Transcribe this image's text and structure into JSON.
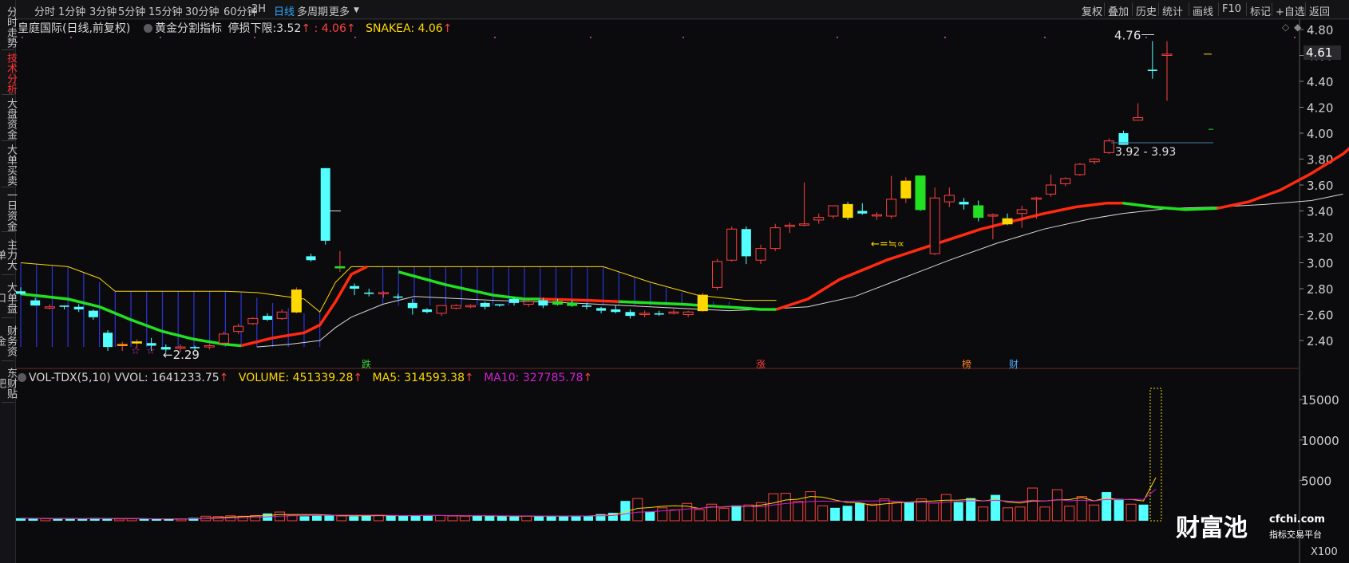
{
  "sidebar": {
    "items": [
      {
        "label": "分时走势",
        "active": false
      },
      {
        "label": "技术分析",
        "active": true
      },
      {
        "label": "大盘资金",
        "active": false
      },
      {
        "label": "大单买卖",
        "active": false
      },
      {
        "label": "一日资金",
        "active": false
      },
      {
        "label": "主力大单",
        "active": false
      },
      {
        "label": "大单盘口",
        "active": false
      },
      {
        "label": "财务资金",
        "active": false
      },
      {
        "label": "东财贴吧",
        "active": false
      }
    ]
  },
  "toolbar": {
    "periods": [
      "分时",
      "1分钟",
      "3分钟",
      "5分钟",
      "15分钟",
      "30分钟",
      "60分钟",
      "2H",
      "日线",
      "多周期",
      "更多"
    ],
    "active_period": "日线",
    "tools": [
      "复权",
      "叠加",
      "历史",
      "统计",
      "画线",
      "F10",
      "标记",
      "+自选",
      "返回"
    ]
  },
  "main": {
    "stock_name": "皇庭国际",
    "chart_mode": "(日线,前复权)",
    "indicator_name": "黄金分割指标",
    "stop_loss_label": "停损下限:",
    "stop_loss_value": "3.52",
    "up_arrow": "↑",
    "second_value": ": 4.06",
    "snake_label": "SNAKEA: 4.06",
    "current_price": "4.61",
    "high_label": "4.76",
    "low_label": "2.29",
    "range_label": "3.92 - 3.93",
    "signal_label": "←=≒∝",
    "y_ticks": [
      "4.80",
      "4.60",
      "4.40",
      "4.20",
      "4.00",
      "3.80",
      "3.60",
      "3.40",
      "3.20",
      "3.00",
      "2.80",
      "2.60",
      "2.40"
    ],
    "markers": [
      {
        "text": "跌",
        "color": "#3ad23a"
      },
      {
        "text": "涨",
        "color": "#ff4040"
      },
      {
        "text": "榜",
        "color": "#ff8020"
      },
      {
        "text": "财",
        "color": "#4aa8ff"
      }
    ],
    "stars": [
      "☆",
      "☆"
    ]
  },
  "volume": {
    "title": "VOL-TDX(5,10)",
    "vvol": "VVOL: 1641233.75",
    "volume": "VOLUME: 451339.28",
    "ma5": "MA5: 314593.38",
    "ma10": "MA10: 327785.78",
    "arrow": "↑",
    "y_ticks": [
      "15000",
      "10000",
      "5000"
    ],
    "unit": "X100"
  },
  "colors": {
    "up": "#ff4040",
    "down": "#54ffff",
    "yellow": "#ffd800",
    "green_line": "#22e022",
    "red_line": "#ff2a10",
    "ma5": "#ffd800",
    "ma10": "#d020d0",
    "active_tab": "#2da8ff"
  },
  "logo": {
    "text": "财富池",
    "url": "cfchi.com",
    "sub": "指标交易平台"
  },
  "chart_data": {
    "type": "candlestick",
    "price_range": [
      2.2,
      4.85
    ],
    "candles": [
      [
        2.78,
        2.81,
        2.75,
        2.76
      ],
      [
        2.71,
        2.73,
        2.68,
        2.67
      ],
      [
        2.65,
        2.68,
        2.64,
        2.66
      ],
      [
        2.67,
        2.67,
        2.64,
        2.66
      ],
      [
        2.66,
        2.68,
        2.62,
        2.64
      ],
      [
        2.63,
        2.64,
        2.56,
        2.58
      ],
      [
        2.46,
        2.48,
        2.32,
        2.35
      ],
      [
        2.36,
        2.39,
        2.32,
        2.37
      ],
      [
        2.38,
        2.41,
        2.34,
        2.39
      ],
      [
        2.38,
        2.42,
        2.32,
        2.36
      ],
      [
        2.35,
        2.37,
        2.31,
        2.33
      ],
      [
        2.34,
        2.37,
        2.31,
        2.35
      ],
      [
        2.35,
        2.36,
        2.32,
        2.34
      ],
      [
        2.35,
        2.37,
        2.33,
        2.36
      ],
      [
        2.38,
        2.47,
        2.37,
        2.45
      ],
      [
        2.47,
        2.53,
        2.45,
        2.51
      ],
      [
        2.53,
        2.58,
        2.52,
        2.57
      ],
      [
        2.59,
        2.61,
        2.55,
        2.56
      ],
      [
        2.57,
        2.64,
        2.56,
        2.62
      ],
      [
        2.62,
        2.81,
        2.61,
        2.79
      ],
      [
        3.05,
        3.07,
        3.01,
        3.02
      ],
      [
        3.73,
        3.73,
        3.14,
        3.17
      ],
      [
        2.96,
        3.09,
        2.93,
        2.97
      ],
      [
        2.82,
        2.84,
        2.75,
        2.8
      ],
      [
        2.77,
        2.8,
        2.74,
        2.76
      ],
      [
        2.76,
        2.78,
        2.73,
        2.77
      ],
      [
        2.74,
        2.76,
        2.72,
        2.73
      ],
      [
        2.69,
        2.72,
        2.6,
        2.65
      ],
      [
        2.64,
        2.65,
        2.61,
        2.62
      ],
      [
        2.61,
        2.67,
        2.59,
        2.67
      ],
      [
        2.65,
        2.68,
        2.64,
        2.67
      ],
      [
        2.66,
        2.68,
        2.65,
        2.67
      ],
      [
        2.69,
        2.7,
        2.64,
        2.66
      ],
      [
        2.68,
        2.68,
        2.66,
        2.67
      ],
      [
        2.72,
        2.73,
        2.67,
        2.69
      ],
      [
        2.68,
        2.71,
        2.66,
        2.7
      ],
      [
        2.71,
        2.73,
        2.65,
        2.67
      ],
      [
        2.7,
        2.72,
        2.67,
        2.68
      ],
      [
        2.69,
        2.71,
        2.66,
        2.67
      ],
      [
        2.67,
        2.69,
        2.64,
        2.66
      ],
      [
        2.65,
        2.66,
        2.61,
        2.63
      ],
      [
        2.64,
        2.67,
        2.61,
        2.62
      ],
      [
        2.62,
        2.64,
        2.57,
        2.59
      ],
      [
        2.6,
        2.63,
        2.58,
        2.61
      ],
      [
        2.61,
        2.63,
        2.59,
        2.6
      ],
      [
        2.61,
        2.64,
        2.6,
        2.62
      ],
      [
        2.6,
        2.63,
        2.58,
        2.62
      ],
      [
        2.63,
        2.77,
        2.62,
        2.75
      ],
      [
        2.81,
        3.03,
        2.79,
        3.01
      ],
      [
        3.02,
        3.28,
        3.01,
        3.26
      ],
      [
        3.26,
        3.28,
        2.99,
        3.05
      ],
      [
        3.02,
        3.14,
        2.99,
        3.11
      ],
      [
        3.11,
        3.3,
        3.09,
        3.27
      ],
      [
        3.28,
        3.31,
        3.23,
        3.29
      ],
      [
        3.29,
        3.62,
        3.28,
        3.3
      ],
      [
        3.33,
        3.38,
        3.3,
        3.35
      ],
      [
        3.36,
        3.44,
        3.34,
        3.44
      ],
      [
        3.45,
        3.47,
        3.33,
        3.35
      ],
      [
        3.4,
        3.46,
        3.37,
        3.38
      ],
      [
        3.37,
        3.39,
        3.33,
        3.37
      ],
      [
        3.36,
        3.67,
        3.34,
        3.49
      ],
      [
        3.5,
        3.66,
        3.46,
        3.63
      ],
      [
        3.67,
        3.67,
        3.4,
        3.41
      ],
      [
        3.07,
        3.58,
        3.06,
        3.5
      ],
      [
        3.47,
        3.58,
        3.43,
        3.52
      ],
      [
        3.47,
        3.5,
        3.41,
        3.45
      ],
      [
        3.44,
        3.48,
        3.32,
        3.35
      ],
      [
        3.36,
        3.38,
        3.18,
        3.37
      ],
      [
        3.34,
        3.38,
        3.29,
        3.3
      ],
      [
        3.38,
        3.44,
        3.27,
        3.41
      ],
      [
        3.49,
        3.51,
        3.34,
        3.5
      ],
      [
        3.53,
        3.68,
        3.51,
        3.6
      ],
      [
        3.61,
        3.66,
        3.59,
        3.65
      ],
      [
        3.68,
        3.77,
        3.67,
        3.76
      ],
      [
        3.78,
        3.81,
        3.76,
        3.8
      ],
      [
        3.85,
        3.96,
        3.84,
        3.94
      ],
      [
        4.0,
        4.02,
        3.91,
        3.91
      ],
      [
        4.1,
        4.23,
        4.1,
        4.12
      ],
      [
        4.49,
        4.71,
        4.42,
        4.48
      ],
      [
        4.6,
        4.71,
        4.25,
        4.61
      ]
    ],
    "volume": [
      310,
      280,
      260,
      240,
      220,
      260,
      340,
      260,
      220,
      250,
      210,
      220,
      230,
      210,
      360,
      560,
      520,
      610,
      560,
      640,
      900,
      1080,
      650,
      560,
      660,
      680,
      590,
      560,
      620,
      700,
      650,
      620,
      640,
      690,
      640,
      590,
      560,
      610,
      590,
      560,
      530,
      590,
      560,
      610,
      590,
      620,
      640,
      820,
      980,
      2450,
      2750,
      1150,
      1600,
      1350,
      2150,
      1380,
      2050,
      1550,
      1900,
      1950,
      2250,
      3350,
      3400,
      2400,
      3600,
      1850,
      1600,
      1850,
      2200,
      2050,
      2700,
      2250,
      2350,
      2700,
      2200,
      3250,
      2300,
      2800,
      1700,
      3200,
      1600,
      1700,
      4050,
      1700,
      3850,
      1800,
      3000,
      1950,
      3550,
      2700,
      2050,
      2000,
      16400
    ],
    "volume_bar_colors": "up/down per candle",
    "volume_range": [
      0,
      17500
    ],
    "ma5": "yellow volume average line",
    "ma10": "purple volume average line"
  }
}
